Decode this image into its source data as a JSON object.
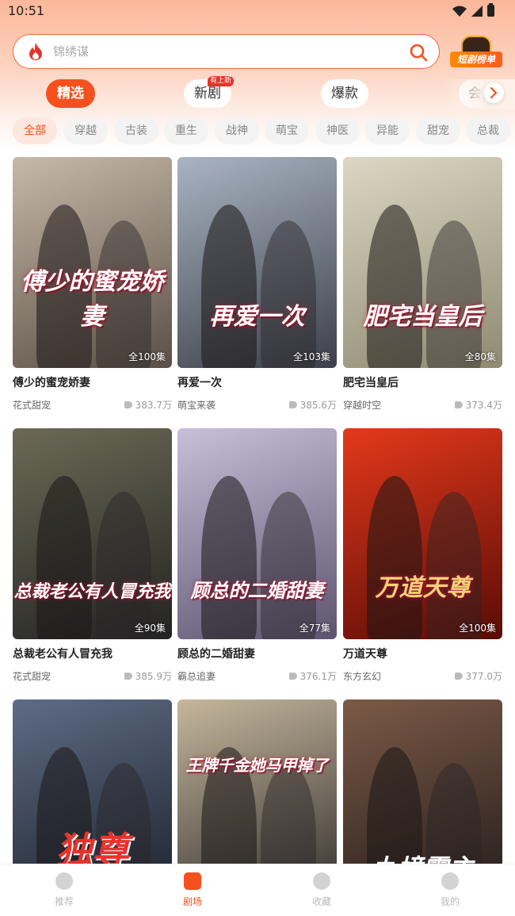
{
  "status_bar": {
    "time": "10:51"
  },
  "search": {
    "placeholder": "锦绣谋",
    "ranking_label": "短剧榜单"
  },
  "tabs": [
    {
      "label": "精选",
      "active": true
    },
    {
      "label": "新剧",
      "badge": "有上新"
    },
    {
      "label": "爆款"
    },
    {
      "label": "会员"
    }
  ],
  "categories": [
    "全部",
    "穿越",
    "古装",
    "重生",
    "战神",
    "萌宝",
    "神医",
    "异能",
    "甜宠",
    "总裁"
  ],
  "dramas": [
    {
      "title": "傅少的蜜宠娇妻",
      "poster_text": "傅少的蜜宠娇妻",
      "episodes": "全100集",
      "genre": "花式甜宠",
      "plays": "383.7万",
      "bg1": "#c7b9a8",
      "bg2": "#5b5046"
    },
    {
      "title": "再爱一次",
      "poster_text": "再爱一次",
      "episodes": "全103集",
      "genre": "萌宝来袭",
      "plays": "385.6万",
      "bg1": "#a9b4c2",
      "bg2": "#3d3f4a"
    },
    {
      "title": "肥宅当皇后",
      "poster_text": "肥宅当皇后",
      "episodes": "全80集",
      "genre": "穿越时空",
      "plays": "373.4万",
      "bg1": "#dcd7c4",
      "bg2": "#8f8a70"
    },
    {
      "title": "总裁老公有人冒充我",
      "poster_text": "总裁老公有人冒充我",
      "episodes": "全90集",
      "genre": "花式甜宠",
      "plays": "385.9万",
      "bg1": "#6c6a55",
      "bg2": "#232323"
    },
    {
      "title": "顾总的二婚甜妻",
      "poster_text": "顾总的二婚甜妻",
      "episodes": "全77集",
      "genre": "霸总追妻",
      "plays": "376.1万",
      "bg1": "#c8bfd9",
      "bg2": "#5d5470"
    },
    {
      "title": "万道天尊",
      "poster_text": "万道天尊",
      "episodes": "全100集",
      "genre": "东方玄幻",
      "plays": "377.0万",
      "bg1": "#e4391b",
      "bg2": "#5a0c06"
    },
    {
      "title": "",
      "poster_text": "独尊",
      "episodes": "",
      "genre": "",
      "plays": "",
      "bg1": "#5e6c84",
      "bg2": "#1b1f2a"
    },
    {
      "title": "",
      "poster_text": "王牌千金她马甲掉了",
      "episodes": "",
      "genre": "",
      "plays": "",
      "bg1": "#c5b79c",
      "bg2": "#2e2b2b"
    },
    {
      "title": "",
      "poster_text": "九境霸主",
      "episodes": "",
      "genre": "",
      "plays": "",
      "bg1": "#7d5a46",
      "bg2": "#1f1a1a"
    }
  ],
  "bottom_nav": [
    {
      "label": "推荐"
    },
    {
      "label": "剧场",
      "active": true
    },
    {
      "label": "收藏"
    },
    {
      "label": "我的"
    }
  ],
  "colors": {
    "accent": "#f4511e",
    "header": "#fbb79a"
  }
}
